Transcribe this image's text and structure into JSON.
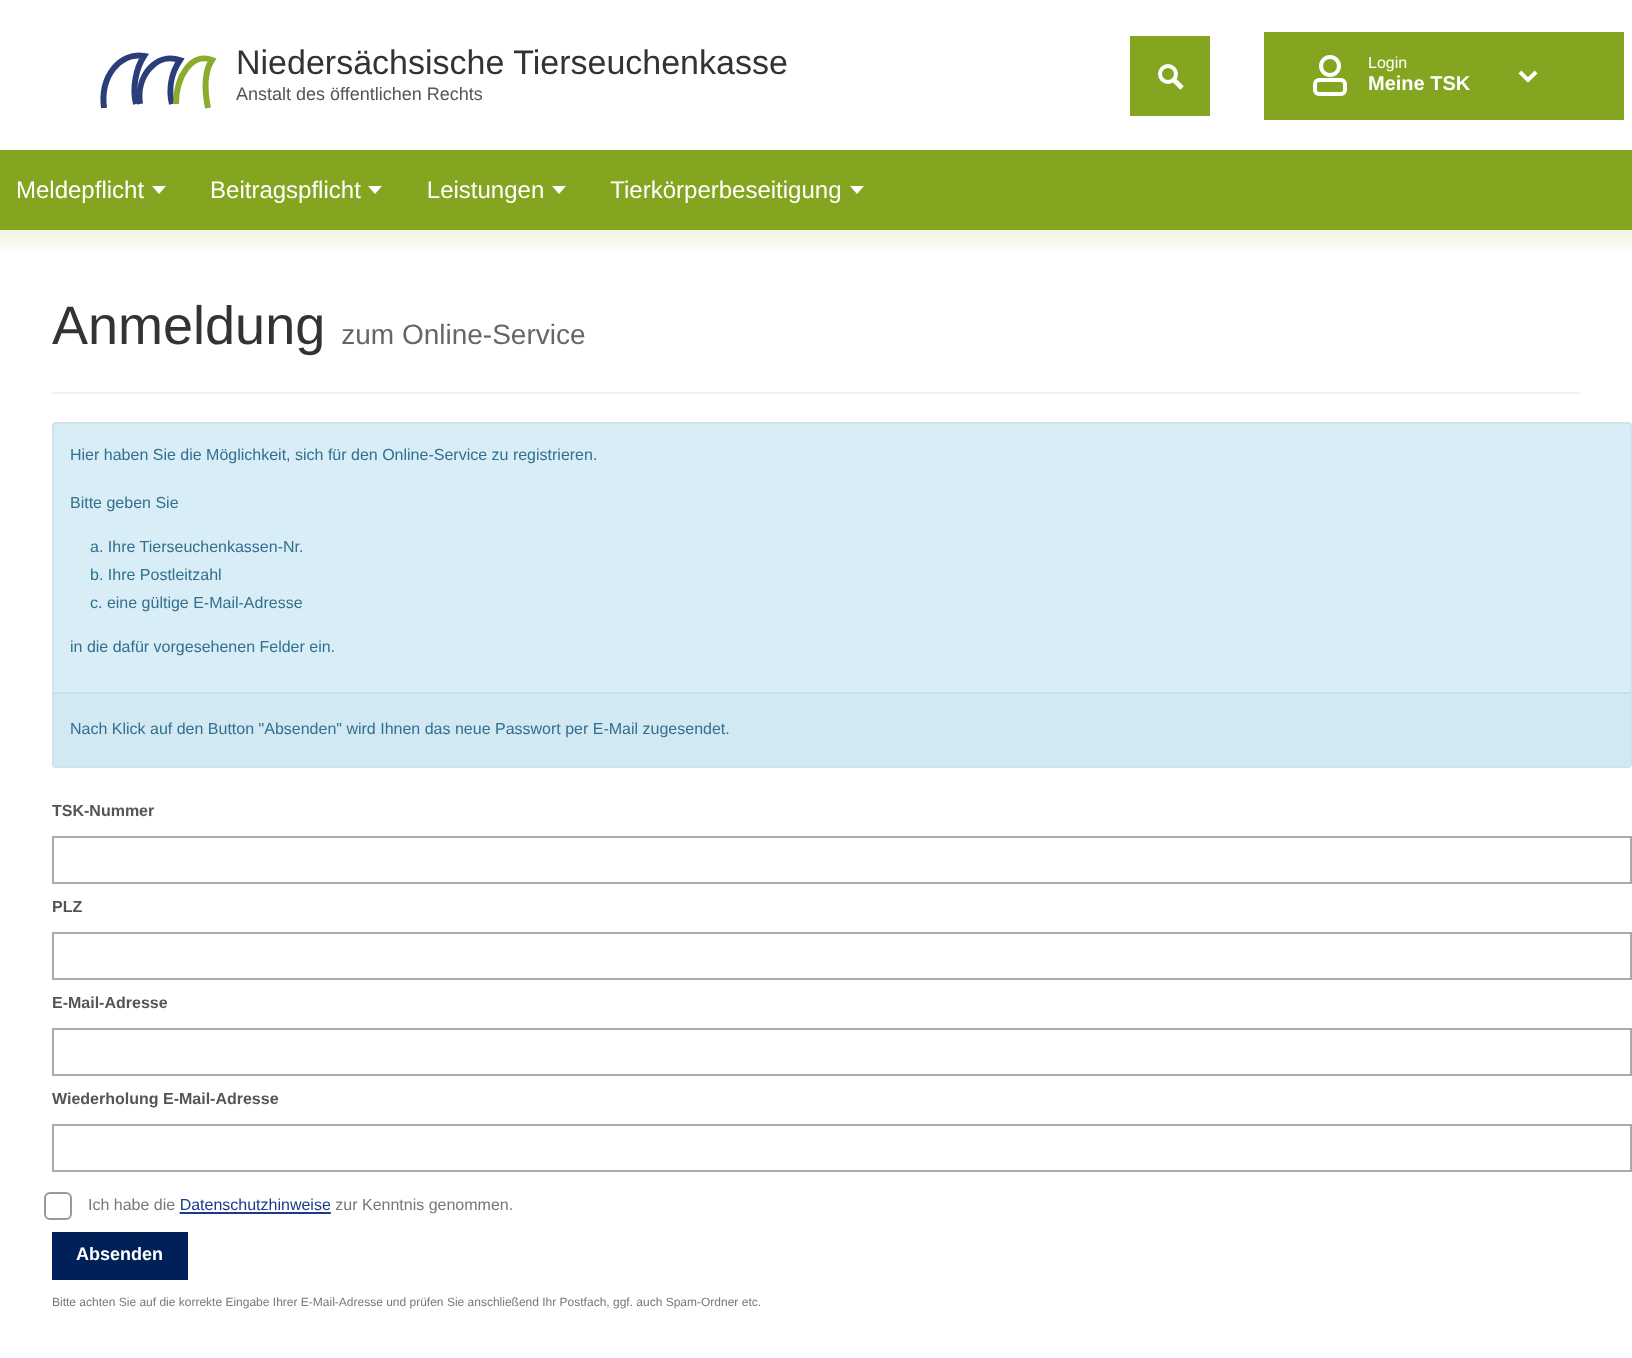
{
  "header": {
    "title": "Niedersächsische Tierseuchenkasse",
    "subtitle": "Anstalt des öffentlichen Rechts",
    "login": {
      "label": "Login",
      "name": "Meine TSK"
    }
  },
  "nav": [
    {
      "label": "Meldepflicht",
      "has_dropdown": true
    },
    {
      "label": "Beitragspflicht",
      "has_dropdown": true
    },
    {
      "label": "Leistungen",
      "has_dropdown": true
    },
    {
      "label": "Tierkörperbeseitigung",
      "has_dropdown": true
    }
  ],
  "heading": {
    "main": "Anmeldung",
    "sub": "zum Online-Service"
  },
  "info": {
    "intro": "Hier haben Sie die Möglichkeit, sich für den Online-Service zu registrieren.",
    "prompt": "Bitte geben Sie",
    "items": [
      {
        "marker": "a.",
        "text": "Ihre Tierseuchenkassen-Nr."
      },
      {
        "marker": "b.",
        "text": "Ihre Postleitzahl"
      },
      {
        "marker": "c.",
        "text": "eine gültige E-Mail-Adresse"
      }
    ],
    "outro": "in die dafür vorgesehenen Felder ein.",
    "footer": "Nach Klick auf den Button \"Absenden\" wird Ihnen das neue Passwort per E-Mail zugesendet."
  },
  "fields": [
    {
      "label": "TSK-Nummer"
    },
    {
      "label": "PLZ"
    },
    {
      "label": "E-Mail-Adresse"
    },
    {
      "label": "Wiederholung E-Mail-Adresse"
    }
  ],
  "consent": {
    "checked": false,
    "before": "Ich habe die",
    "link": "Datenschutzhinweise",
    "after": "zur Kenntnis genommen."
  },
  "submit": "Absenden",
  "note": "Bitte achten Sie auf die korrekte Eingabe Ihrer E-Mail-Adresse und prüfen Sie anschließend Ihr Postfach, ggf. auch Spam-Ordner etc."
}
